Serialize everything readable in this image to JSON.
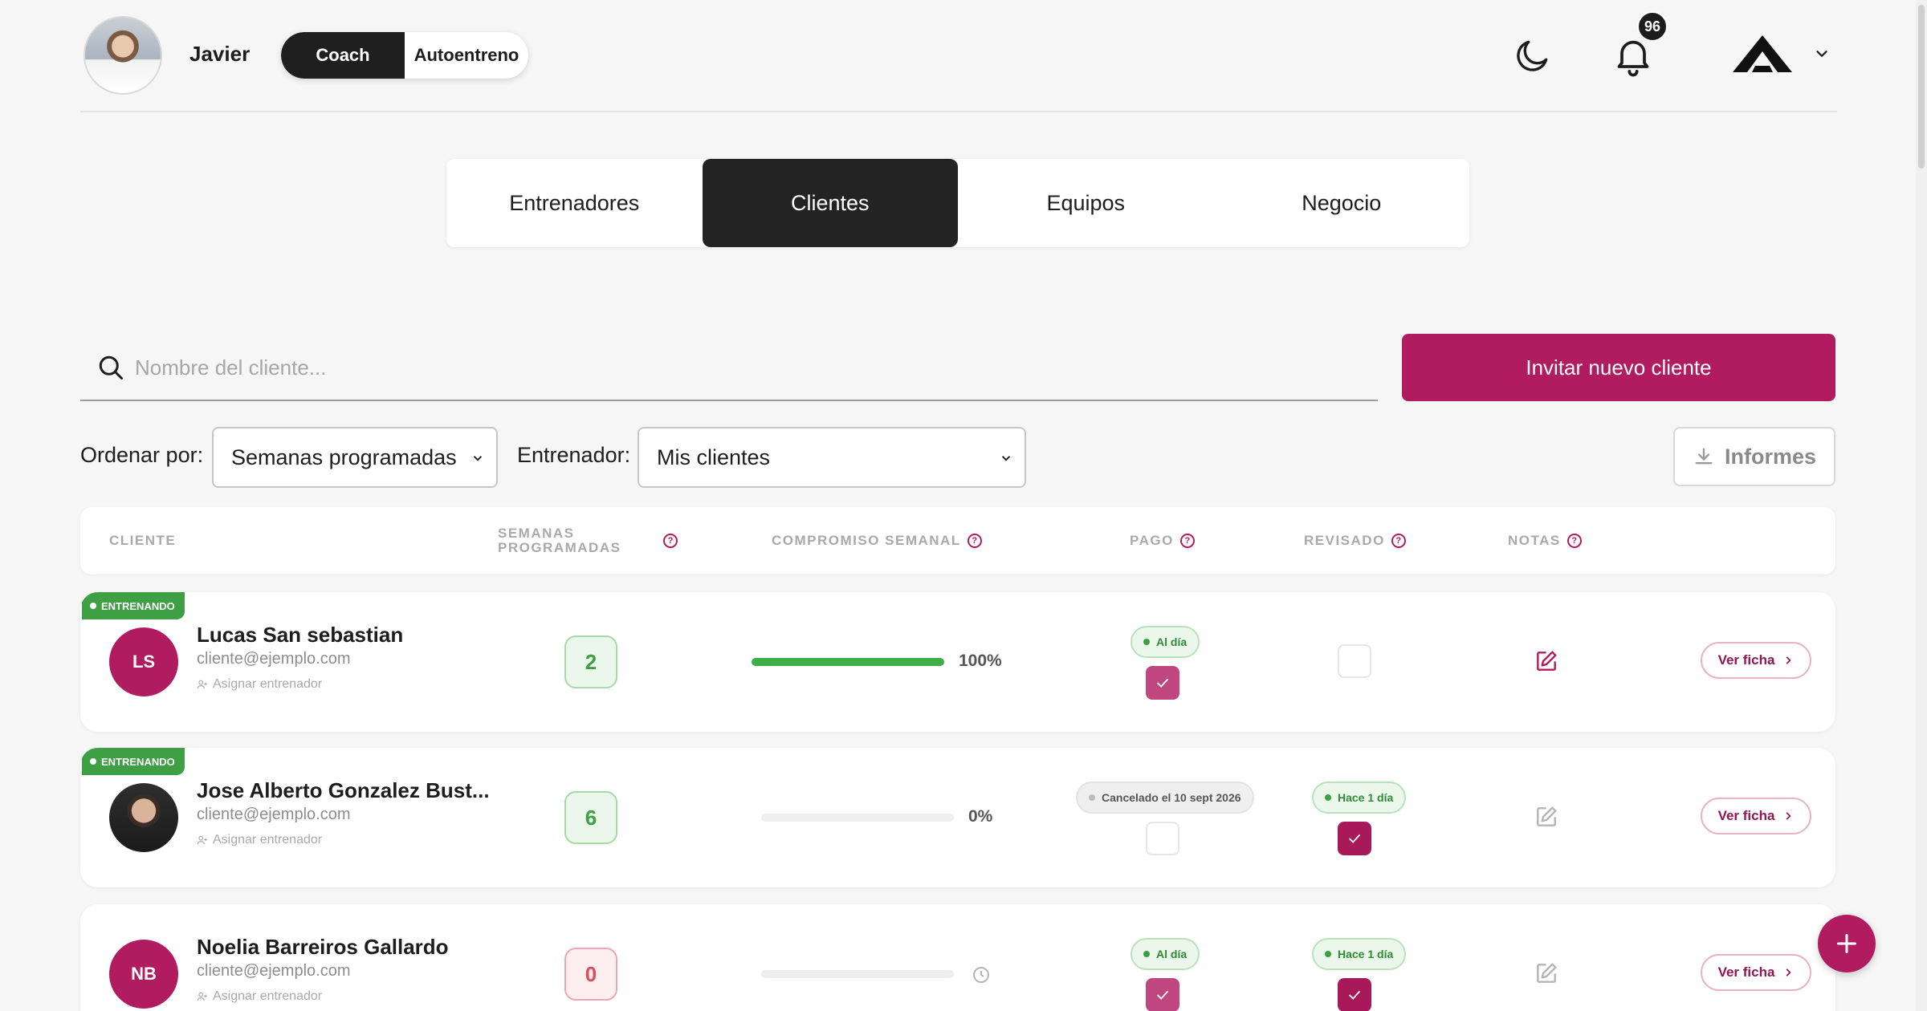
{
  "header": {
    "user_name": "Javier",
    "mode_active": "Coach",
    "mode_inactive": "Autoentreno",
    "notifications_count": "96"
  },
  "tabs": [
    {
      "label": "Entrenadores",
      "active": false
    },
    {
      "label": "Clientes",
      "active": true
    },
    {
      "label": "Equipos",
      "active": false
    },
    {
      "label": "Negocio",
      "active": false
    }
  ],
  "search": {
    "placeholder": "Nombre del cliente...",
    "value": ""
  },
  "invite_button": "Invitar nuevo cliente",
  "filters": {
    "sort_label": "Ordenar por:",
    "sort_value": "Semanas programadas",
    "trainer_label": "Entrenador:",
    "trainer_value": "Mis clientes",
    "reports_button": "Informes"
  },
  "table": {
    "headers": {
      "client": "CLIENTE",
      "weeks_line1": "SEMANAS",
      "weeks_line2": "PROGRAMADAS",
      "commitment": "COMPROMISO SEMANAL",
      "payment": "PAGO",
      "reviewed": "REVISADO",
      "notes": "NOTAS",
      "help": "?"
    },
    "rows": [
      {
        "status": "ENTRENANDO",
        "initials": "LS",
        "name": "Lucas San sebastian",
        "email": "cliente@ejemplo.com",
        "assign": "Asignar entrenador",
        "weeks": "2",
        "commitment_pct": 100,
        "commitment_label": "100%",
        "payment_pill": "Al día",
        "payment_checked": true,
        "reviewed_pill": "",
        "reviewed_checked": false,
        "view": "Ver ficha"
      },
      {
        "status": "ENTRENANDO",
        "initials": "",
        "name": "Jose Alberto Gonzalez Bust...",
        "email": "cliente@ejemplo.com",
        "assign": "Asignar entrenador",
        "weeks": "6",
        "commitment_pct": 0,
        "commitment_label": "0%",
        "payment_pill": "Cancelado el 10 sept 2026",
        "payment_checked": false,
        "reviewed_pill": "Hace 1 día",
        "reviewed_checked": true,
        "view": "Ver ficha"
      },
      {
        "status": "",
        "initials": "NB",
        "name": "Noelia Barreiros Gallardo",
        "email": "cliente@ejemplo.com",
        "assign": "Asignar entrenador",
        "weeks": "0",
        "commitment_pct": 0,
        "commitment_label": "",
        "payment_pill": "Al día",
        "payment_checked": true,
        "reviewed_pill": "Hace 1 día",
        "reviewed_checked": true,
        "view": "Ver ficha"
      }
    ]
  },
  "colors": {
    "brand": "#b01c5f",
    "success": "#3f9f45",
    "dark": "#1f1f1f"
  },
  "icons": [
    "moon-icon",
    "bell-icon",
    "logo-icon",
    "chevron-down-icon",
    "search-icon",
    "download-icon",
    "question-icon",
    "user-plus-icon",
    "check-icon",
    "edit-icon",
    "chevron-right-icon",
    "clock-icon",
    "plus-icon"
  ]
}
